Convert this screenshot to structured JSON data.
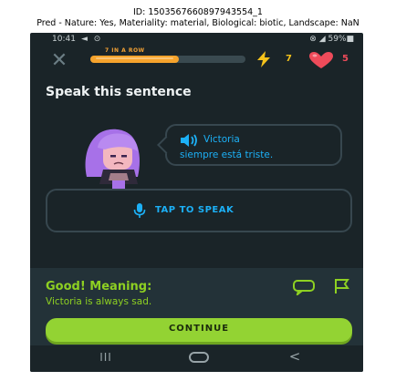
{
  "caption": {
    "id_line": "ID: 1503567660897943554_1",
    "pred_line": "Pred - Nature: Yes, Materiality: material, Biological: biotic, Landscape: NaN"
  },
  "status_bar": {
    "time": "10:41",
    "left_icons": "◄ ⊙",
    "right": "⊗ ◢ 59%■"
  },
  "top_bar": {
    "close_glyph": "✕",
    "streak_label": "7 IN A ROW",
    "progress_fraction": 0.57,
    "bolt_count": "7",
    "hearts_count": "5"
  },
  "challenge": {
    "title": "Speak this sentence",
    "line1": "Victoria",
    "line2": "siempre está triste.",
    "tap_label": "TAP TO SPEAK"
  },
  "feedback": {
    "title": "Good! Meaning:",
    "text": "Victoria is always sad.",
    "continue_label": "CONTINUE"
  },
  "nav": {
    "recents": "III",
    "back": "<"
  },
  "colors": {
    "background": "#1a2428",
    "accent_blue": "#1cb0f6",
    "success_green": "#93d333",
    "streak_orange": "#f6a32c",
    "heart_red": "#ee4b5a"
  }
}
